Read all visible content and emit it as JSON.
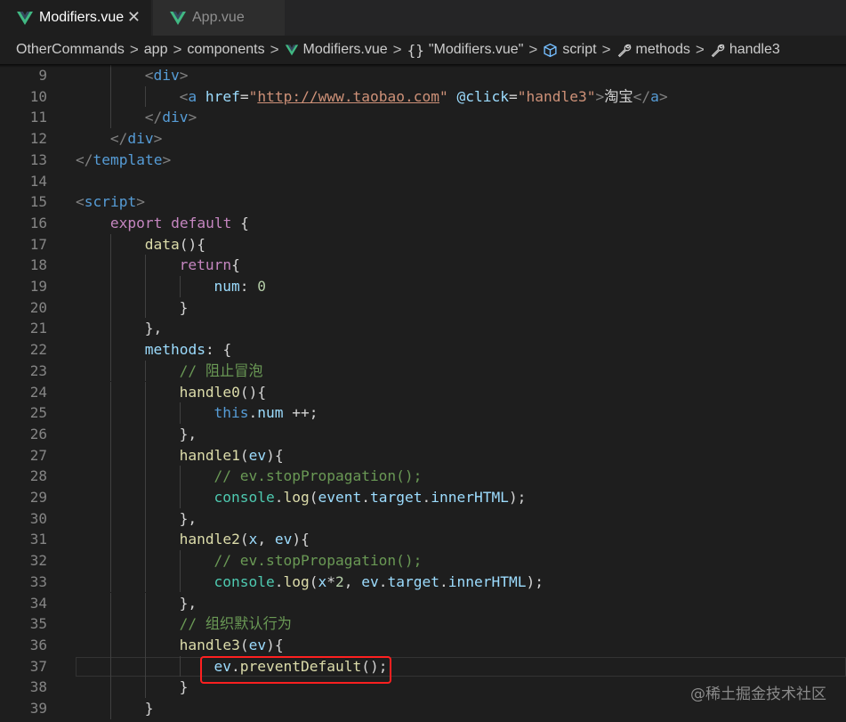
{
  "tabs": [
    {
      "label": "Modifiers.vue",
      "active": true,
      "icon": "vue-icon"
    },
    {
      "label": "App.vue",
      "active": false,
      "icon": "vue-icon"
    }
  ],
  "close_glyph": "✕",
  "breadcrumb": {
    "items": [
      "OtherCommands",
      "app",
      "components",
      "Modifiers.vue",
      "\"Modifiers.vue\"",
      "script",
      "methods",
      "handle3"
    ],
    "separator": ">"
  },
  "editor": {
    "line_numbers": [
      "9",
      "10",
      "11",
      "12",
      "13",
      "14",
      "15",
      "16",
      "17",
      "18",
      "19",
      "20",
      "21",
      "22",
      "23",
      "24",
      "25",
      "26",
      "27",
      "28",
      "29",
      "30",
      "31",
      "32",
      "33",
      "34",
      "35",
      "36",
      "37",
      "38",
      "39"
    ],
    "lines": [
      [
        {
          "t": "<",
          "c": "punc"
        },
        {
          "t": "div",
          "c": "tag"
        },
        {
          "t": ">",
          "c": "punc"
        }
      ],
      [
        {
          "t": "<",
          "c": "punc"
        },
        {
          "t": "a ",
          "c": "tag"
        },
        {
          "t": "href",
          "c": "attr"
        },
        {
          "t": "=",
          "c": "txt"
        },
        {
          "t": "\"",
          "c": "str"
        },
        {
          "t": "http://www.taobao.com",
          "c": "url"
        },
        {
          "t": "\"",
          "c": "str"
        },
        {
          "t": " @click",
          "c": "attr"
        },
        {
          "t": "=",
          "c": "txt"
        },
        {
          "t": "\"handle3\"",
          "c": "str"
        },
        {
          "t": ">",
          "c": "punc"
        },
        {
          "t": "淘宝",
          "c": "txt"
        },
        {
          "t": "</",
          "c": "punc"
        },
        {
          "t": "a",
          "c": "tag"
        },
        {
          "t": ">",
          "c": "punc"
        }
      ],
      [
        {
          "t": "</",
          "c": "punc"
        },
        {
          "t": "div",
          "c": "tag"
        },
        {
          "t": ">",
          "c": "punc"
        }
      ],
      [
        {
          "t": "</",
          "c": "punc"
        },
        {
          "t": "div",
          "c": "tag"
        },
        {
          "t": ">",
          "c": "punc"
        }
      ],
      [
        {
          "t": "</",
          "c": "punc"
        },
        {
          "t": "template",
          "c": "tag"
        },
        {
          "t": ">",
          "c": "punc"
        }
      ],
      [],
      [
        {
          "t": "<",
          "c": "punc"
        },
        {
          "t": "script",
          "c": "tag"
        },
        {
          "t": ">",
          "c": "punc"
        }
      ],
      [
        {
          "t": "export ",
          "c": "kw"
        },
        {
          "t": "default ",
          "c": "kw"
        },
        {
          "t": "{",
          "c": "brace"
        }
      ],
      [
        {
          "t": "data",
          "c": "fn"
        },
        {
          "t": "(){",
          "c": "txt"
        }
      ],
      [
        {
          "t": "return",
          "c": "kw"
        },
        {
          "t": "{",
          "c": "brace"
        }
      ],
      [
        {
          "t": "num",
          "c": "var"
        },
        {
          "t": ": ",
          "c": "txt"
        },
        {
          "t": "0",
          "c": "num"
        }
      ],
      [
        {
          "t": "}",
          "c": "brace"
        }
      ],
      [
        {
          "t": "},",
          "c": "txt"
        }
      ],
      [
        {
          "t": "methods",
          "c": "var"
        },
        {
          "t": ": {",
          "c": "txt"
        }
      ],
      [
        {
          "t": "// 阻止冒泡",
          "c": "cmt"
        }
      ],
      [
        {
          "t": "handle0",
          "c": "fn"
        },
        {
          "t": "(){",
          "c": "txt"
        }
      ],
      [
        {
          "t": "this",
          "c": "this"
        },
        {
          "t": ".",
          "c": "txt"
        },
        {
          "t": "num",
          "c": "var"
        },
        {
          "t": " ++;",
          "c": "txt"
        }
      ],
      [
        {
          "t": "},",
          "c": "txt"
        }
      ],
      [
        {
          "t": "handle1",
          "c": "fn"
        },
        {
          "t": "(",
          "c": "txt"
        },
        {
          "t": "ev",
          "c": "var"
        },
        {
          "t": "){",
          "c": "txt"
        }
      ],
      [
        {
          "t": "// ev.stopPropagation();",
          "c": "cmt"
        }
      ],
      [
        {
          "t": "console",
          "c": "cls"
        },
        {
          "t": ".",
          "c": "txt"
        },
        {
          "t": "log",
          "c": "fn"
        },
        {
          "t": "(",
          "c": "txt"
        },
        {
          "t": "event",
          "c": "var"
        },
        {
          "t": ".",
          "c": "txt"
        },
        {
          "t": "target",
          "c": "var"
        },
        {
          "t": ".",
          "c": "txt"
        },
        {
          "t": "innerHTML",
          "c": "var"
        },
        {
          "t": ");",
          "c": "txt"
        }
      ],
      [
        {
          "t": "},",
          "c": "txt"
        }
      ],
      [
        {
          "t": "handle2",
          "c": "fn"
        },
        {
          "t": "(",
          "c": "txt"
        },
        {
          "t": "x",
          "c": "var"
        },
        {
          "t": ", ",
          "c": "txt"
        },
        {
          "t": "ev",
          "c": "var"
        },
        {
          "t": "){",
          "c": "txt"
        }
      ],
      [
        {
          "t": "// ev.stopPropagation();",
          "c": "cmt"
        }
      ],
      [
        {
          "t": "console",
          "c": "cls"
        },
        {
          "t": ".",
          "c": "txt"
        },
        {
          "t": "log",
          "c": "fn"
        },
        {
          "t": "(",
          "c": "txt"
        },
        {
          "t": "x",
          "c": "var"
        },
        {
          "t": "*",
          "c": "txt"
        },
        {
          "t": "2",
          "c": "num"
        },
        {
          "t": ", ",
          "c": "txt"
        },
        {
          "t": "ev",
          "c": "var"
        },
        {
          "t": ".",
          "c": "txt"
        },
        {
          "t": "target",
          "c": "var"
        },
        {
          "t": ".",
          "c": "txt"
        },
        {
          "t": "innerHTML",
          "c": "var"
        },
        {
          "t": ");",
          "c": "txt"
        }
      ],
      [
        {
          "t": "},",
          "c": "txt"
        }
      ],
      [
        {
          "t": "// 组织默认行为",
          "c": "cmt"
        }
      ],
      [
        {
          "t": "handle3",
          "c": "fn"
        },
        {
          "t": "(",
          "c": "txt"
        },
        {
          "t": "ev",
          "c": "var"
        },
        {
          "t": "){",
          "c": "txt"
        }
      ],
      [
        {
          "t": "ev",
          "c": "var"
        },
        {
          "t": ".",
          "c": "txt"
        },
        {
          "t": "preventDefault",
          "c": "fn"
        },
        {
          "t": "();",
          "c": "txt"
        }
      ],
      [
        {
          "t": "}",
          "c": "brace"
        }
      ],
      [
        {
          "t": "}",
          "c": "brace"
        }
      ]
    ],
    "current_line": "37",
    "highlighted_line": "37"
  },
  "watermark": "@稀土掘金技术社区",
  "colors": {
    "background": "#1e1e1e",
    "vue_green": "#41b883",
    "highlight_border": "#ff2020"
  }
}
